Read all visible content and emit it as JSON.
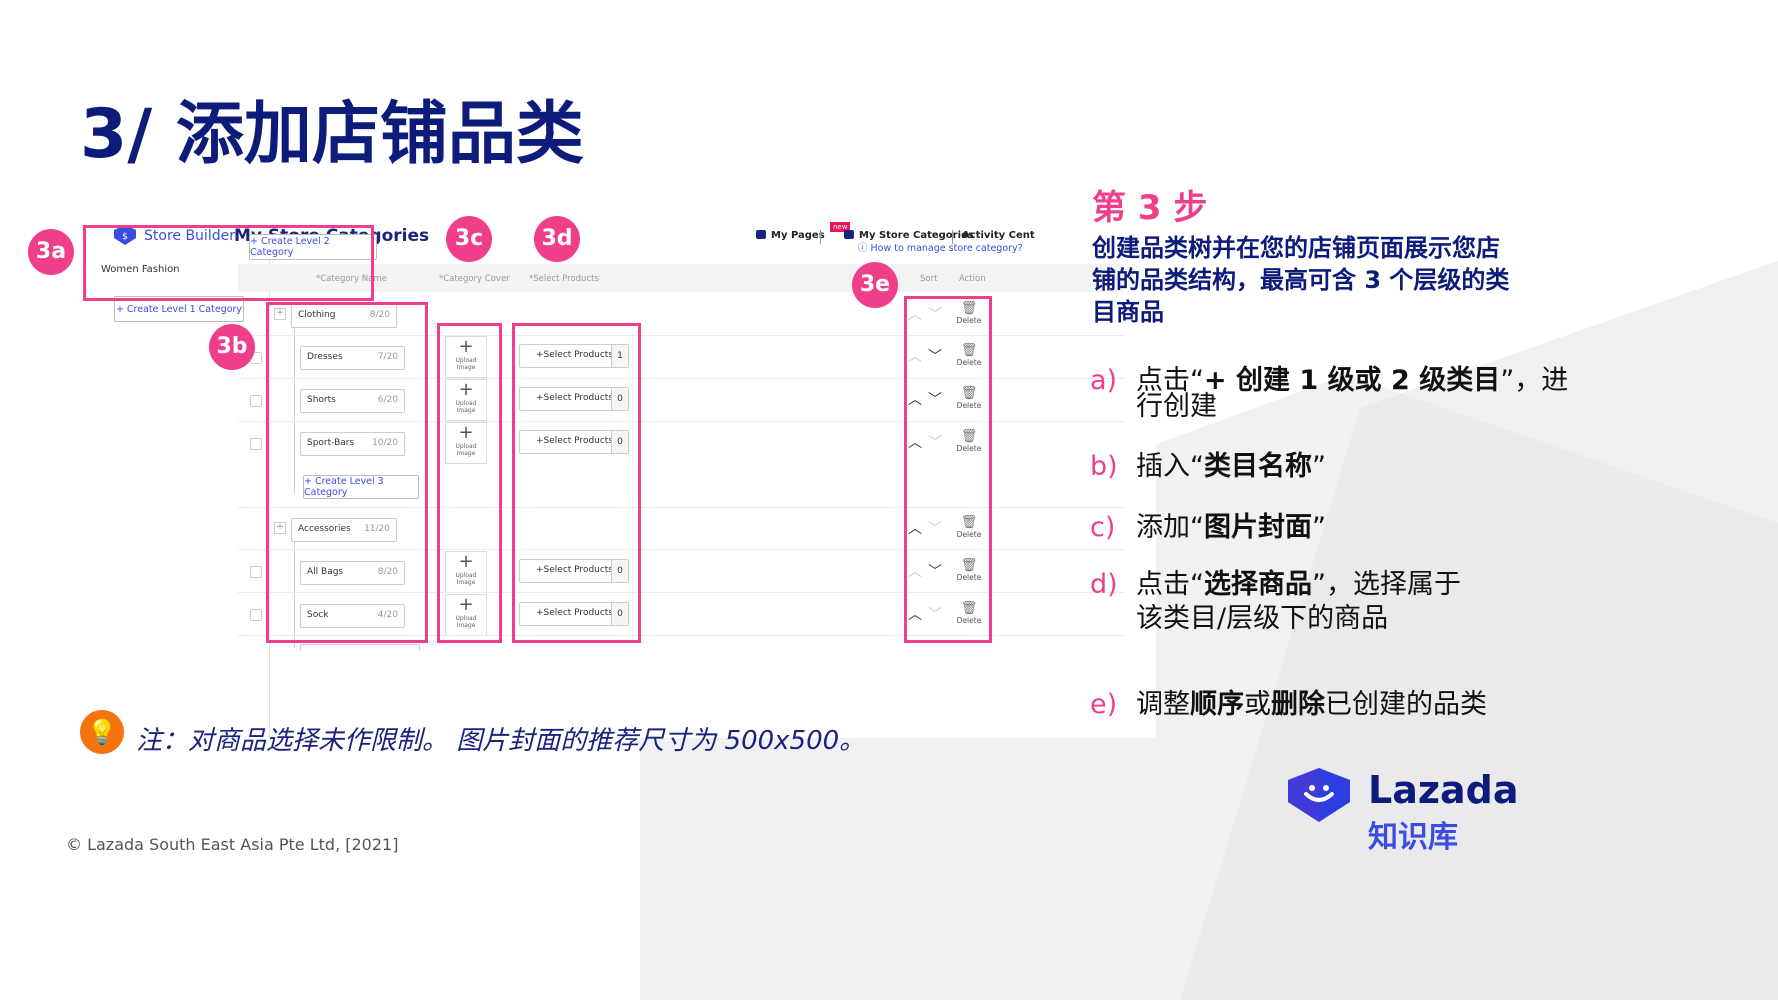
{
  "slide": {
    "title": "3/ 添加店铺品类",
    "note": "注：对商品选择未作限制。 图片封面的推荐尺寸为 500x500。",
    "copyright": "© Lazada South East Asia Pte Ltd, [2021]"
  },
  "screenshot": {
    "brand": "Store Builder",
    "page_title": "My Store Categories",
    "nav": [
      "My Pages",
      "My Store Categories",
      "Activity Cent"
    ],
    "new_badge": "new",
    "left_category": "Women Fashion",
    "create_l1": "+ Create Level 1 Category",
    "create_l2": "+ Create Level 2 Category",
    "create_l3": "+ Create Level 3 Category",
    "help_link": "How to manage store category?",
    "headers": {
      "name": "*Category Name",
      "cover": "*Category Cover",
      "products": "*Select Products",
      "sort": "Sort",
      "action": "Action"
    },
    "upload_label": "Upload Image",
    "select_label": "+Select Products",
    "delete_label": "Delete",
    "rows": [
      {
        "name": "Clothing",
        "count": "8/20"
      },
      {
        "name": "Dresses",
        "count": "7/20",
        "products": "1"
      },
      {
        "name": "Shorts",
        "count": "6/20",
        "products": "0"
      },
      {
        "name": "Sport-Bars",
        "count": "10/20",
        "products": "0"
      },
      {
        "name": "Accessories",
        "count": "11/20"
      },
      {
        "name": "All Bags",
        "count": "8/20",
        "products": "0"
      },
      {
        "name": "Sock",
        "count": "4/20",
        "products": "0"
      }
    ]
  },
  "badges": [
    "3a",
    "3b",
    "3c",
    "3d",
    "3e"
  ],
  "instructions": {
    "step": "第 3 步",
    "description": "创建品类树并在您的店铺页面展示您店铺的品类结构，最高可含 3 个层级的类目商品",
    "items": [
      {
        "letter": "a)",
        "pre": "点击“",
        "bold": "+ 创建 1 级或 2 级类目",
        "post": "”，进",
        "line2": "行创建"
      },
      {
        "letter": "b)",
        "pre": "插入“",
        "bold": "类目名称",
        "post": "”"
      },
      {
        "letter": "c)",
        "pre": "添加“",
        "bold": "图片封面",
        "post": "”"
      },
      {
        "letter": "d)",
        "pre": "点击“",
        "bold": "选择商品",
        "post": "”，选择属于",
        "line2": "该类目/层级下的商品"
      },
      {
        "letter": "e)",
        "pre": "调整",
        "bold": "顺序",
        "mid": "或",
        "bold2": "删除",
        "post": "已创建的品类"
      }
    ]
  },
  "logo": {
    "name": "Lazada",
    "sub": "知识库"
  },
  "colors": {
    "navy": "#0d1b7a",
    "pink": "#ef3f8b",
    "blue": "#3b4de0",
    "orange": "#f5740f"
  }
}
